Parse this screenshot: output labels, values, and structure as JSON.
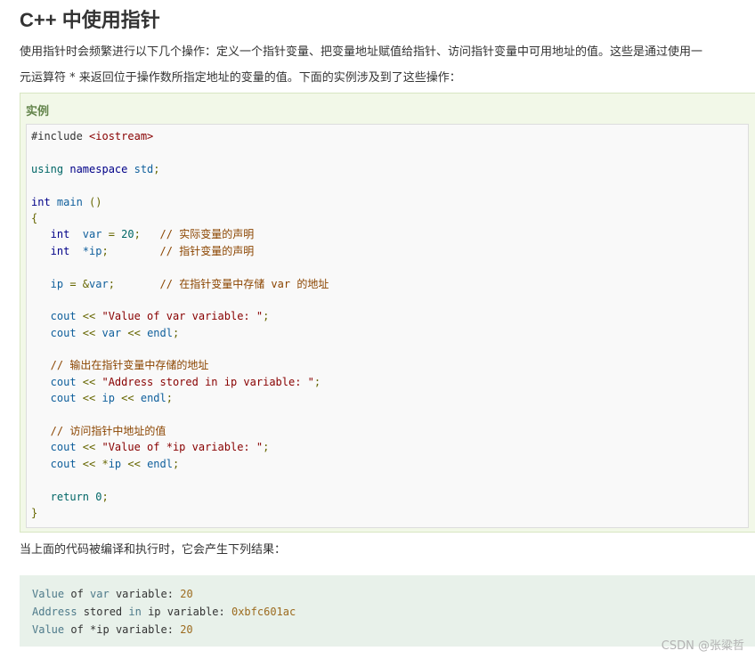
{
  "title": "C++ 中使用指针",
  "intro": {
    "line1": "使用指针时会频繁进行以下几个操作：定义一个指针变量、把变量地址赋值给指针、访问指针变量中可用地址的值。这些是通过使用一",
    "line2": "元运算符 * 来返回位于操作数所指定地址的变量的值。下面的实例涉及到了这些操作："
  },
  "example": {
    "label": "实例",
    "code": [
      [
        {
          "t": "#include ",
          "c": ""
        },
        {
          "t": "<iostream>",
          "c": "prp"
        }
      ],
      [],
      [
        {
          "t": "using",
          "c": "kw"
        },
        {
          "t": " namespace ",
          "c": "typ"
        },
        {
          "t": "std",
          "c": "fn"
        },
        {
          "t": ";",
          "c": "pun"
        }
      ],
      [],
      [
        {
          "t": "int",
          "c": "typ"
        },
        {
          "t": " main ",
          "c": "fn"
        },
        {
          "t": "()",
          "c": "pun"
        }
      ],
      [
        {
          "t": "{",
          "c": "pun"
        }
      ],
      [
        {
          "t": "   int  ",
          "c": "typ"
        },
        {
          "t": "var",
          "c": "fn"
        },
        {
          "t": " = ",
          "c": "pun"
        },
        {
          "t": "20",
          "c": "num"
        },
        {
          "t": ";   ",
          "c": "pun"
        },
        {
          "t": "// 实际变量的声明",
          "c": "com"
        }
      ],
      [
        {
          "t": "   int  ",
          "c": "typ"
        },
        {
          "t": "*ip",
          "c": "fn"
        },
        {
          "t": ";        ",
          "c": "pun"
        },
        {
          "t": "// 指针变量的声明",
          "c": "com"
        }
      ],
      [],
      [
        {
          "t": "   ip",
          "c": "fn"
        },
        {
          "t": " = &",
          "c": "pun"
        },
        {
          "t": "var",
          "c": "fn"
        },
        {
          "t": ";       ",
          "c": "pun"
        },
        {
          "t": "// 在指针变量中存储 var 的地址",
          "c": "com"
        }
      ],
      [],
      [
        {
          "t": "   cout",
          "c": "fn"
        },
        {
          "t": " << ",
          "c": "pun"
        },
        {
          "t": "\"Value of var variable: \"",
          "c": "str"
        },
        {
          "t": ";",
          "c": "pun"
        }
      ],
      [
        {
          "t": "   cout",
          "c": "fn"
        },
        {
          "t": " << ",
          "c": "pun"
        },
        {
          "t": "var",
          "c": "fn"
        },
        {
          "t": " << ",
          "c": "pun"
        },
        {
          "t": "endl",
          "c": "fn"
        },
        {
          "t": ";",
          "c": "pun"
        }
      ],
      [],
      [
        {
          "t": "   // 输出在指针变量中存储的地址",
          "c": "com"
        }
      ],
      [
        {
          "t": "   cout",
          "c": "fn"
        },
        {
          "t": " << ",
          "c": "pun"
        },
        {
          "t": "\"Address stored in ip variable: \"",
          "c": "str"
        },
        {
          "t": ";",
          "c": "pun"
        }
      ],
      [
        {
          "t": "   cout",
          "c": "fn"
        },
        {
          "t": " << ",
          "c": "pun"
        },
        {
          "t": "ip",
          "c": "fn"
        },
        {
          "t": " << ",
          "c": "pun"
        },
        {
          "t": "endl",
          "c": "fn"
        },
        {
          "t": ";",
          "c": "pun"
        }
      ],
      [],
      [
        {
          "t": "   // 访问指针中地址的值",
          "c": "com"
        }
      ],
      [
        {
          "t": "   cout",
          "c": "fn"
        },
        {
          "t": " << ",
          "c": "pun"
        },
        {
          "t": "\"Value of *ip variable: \"",
          "c": "str"
        },
        {
          "t": ";",
          "c": "pun"
        }
      ],
      [
        {
          "t": "   cout",
          "c": "fn"
        },
        {
          "t": " << *",
          "c": "pun"
        },
        {
          "t": "ip",
          "c": "fn"
        },
        {
          "t": " << ",
          "c": "pun"
        },
        {
          "t": "endl",
          "c": "fn"
        },
        {
          "t": ";",
          "c": "pun"
        }
      ],
      [],
      [
        {
          "t": "   return ",
          "c": "kw"
        },
        {
          "t": "0",
          "c": "num"
        },
        {
          "t": ";",
          "c": "pun"
        }
      ],
      [
        {
          "t": "}",
          "c": "pun"
        }
      ]
    ]
  },
  "result_text": "当上面的代码被编译和执行时，它会产生下列结果：",
  "output": [
    [
      {
        "t": "Value ",
        "c": "o-kw"
      },
      {
        "t": "of ",
        "c": ""
      },
      {
        "t": "var",
        "c": "o-kw"
      },
      {
        "t": " variable: ",
        "c": ""
      },
      {
        "t": "20",
        "c": "o-num"
      }
    ],
    [
      {
        "t": "Address ",
        "c": "o-kw"
      },
      {
        "t": "stored ",
        "c": ""
      },
      {
        "t": "in ",
        "c": "o-kw"
      },
      {
        "t": "ip variable: ",
        "c": ""
      },
      {
        "t": "0xbfc601ac",
        "c": "o-num"
      }
    ],
    [
      {
        "t": "Value ",
        "c": "o-kw"
      },
      {
        "t": "of ",
        "c": ""
      },
      {
        "t": "*ip variable: ",
        "c": ""
      },
      {
        "t": "20",
        "c": "o-num"
      }
    ]
  ],
  "watermark": "CSDN @张粱哲"
}
